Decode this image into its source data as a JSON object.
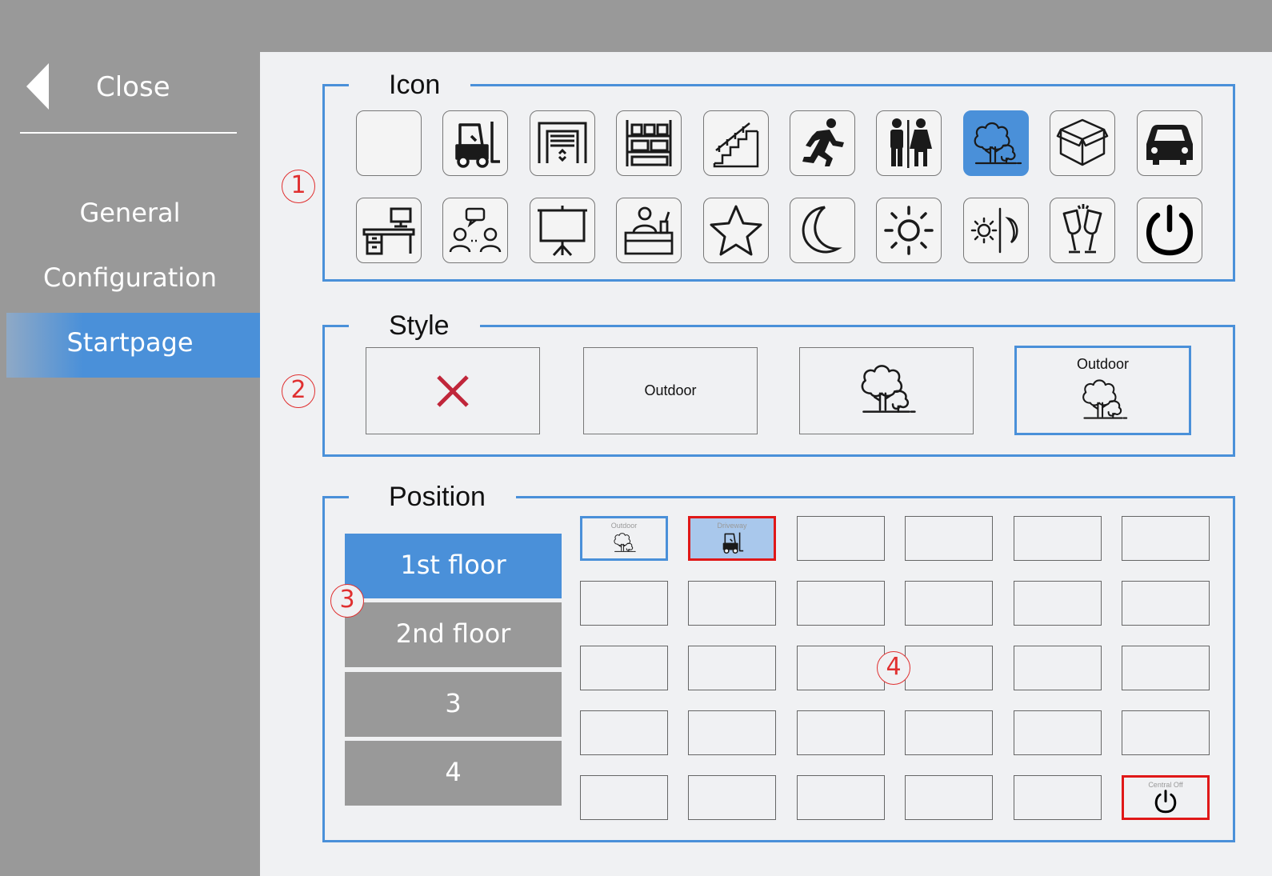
{
  "sidebar": {
    "close_label": "Close",
    "nav": [
      {
        "label": "General"
      },
      {
        "label": "Configuration"
      },
      {
        "label": "Startpage"
      }
    ]
  },
  "groups": {
    "icon": {
      "legend": "Icon",
      "marker": "1"
    },
    "style": {
      "legend": "Style",
      "marker": "2"
    },
    "position": {
      "legend": "Position",
      "marker_floors": "3",
      "marker_grid": "4"
    }
  },
  "icons": [
    "empty-icon",
    "forklift-icon",
    "garage-door-icon",
    "shelves-icon",
    "stairs-icon",
    "running-person-icon",
    "restroom-icon",
    "tree-icon",
    "box-icon",
    "car-icon",
    "desk-icon",
    "meeting-icon",
    "presentation-board-icon",
    "reception-icon",
    "star-icon",
    "moon-icon",
    "sun-icon",
    "day-night-icon",
    "champagne-icon",
    "power-icon"
  ],
  "selected_icon": "tree-icon",
  "style_options": [
    {
      "kind": "none"
    },
    {
      "kind": "text",
      "text": "Outdoor"
    },
    {
      "kind": "icon"
    },
    {
      "kind": "text-icon",
      "text": "Outdoor",
      "selected": true
    }
  ],
  "floors": [
    {
      "label": "1st floor",
      "active": true
    },
    {
      "label": "2nd floor"
    },
    {
      "label": "3"
    },
    {
      "label": "4"
    }
  ],
  "position_cells": {
    "outdoor": {
      "label": "Outdoor",
      "icon": "tree-icon"
    },
    "driveway": {
      "label": "Driveway",
      "icon": "forklift-icon"
    },
    "central_off": {
      "label": "Central Off",
      "icon": "power-icon"
    }
  },
  "colors": {
    "accent": "#4a90d9",
    "marker": "#e03030",
    "highlight_border": "#e01818",
    "sidebar": "#999999"
  }
}
